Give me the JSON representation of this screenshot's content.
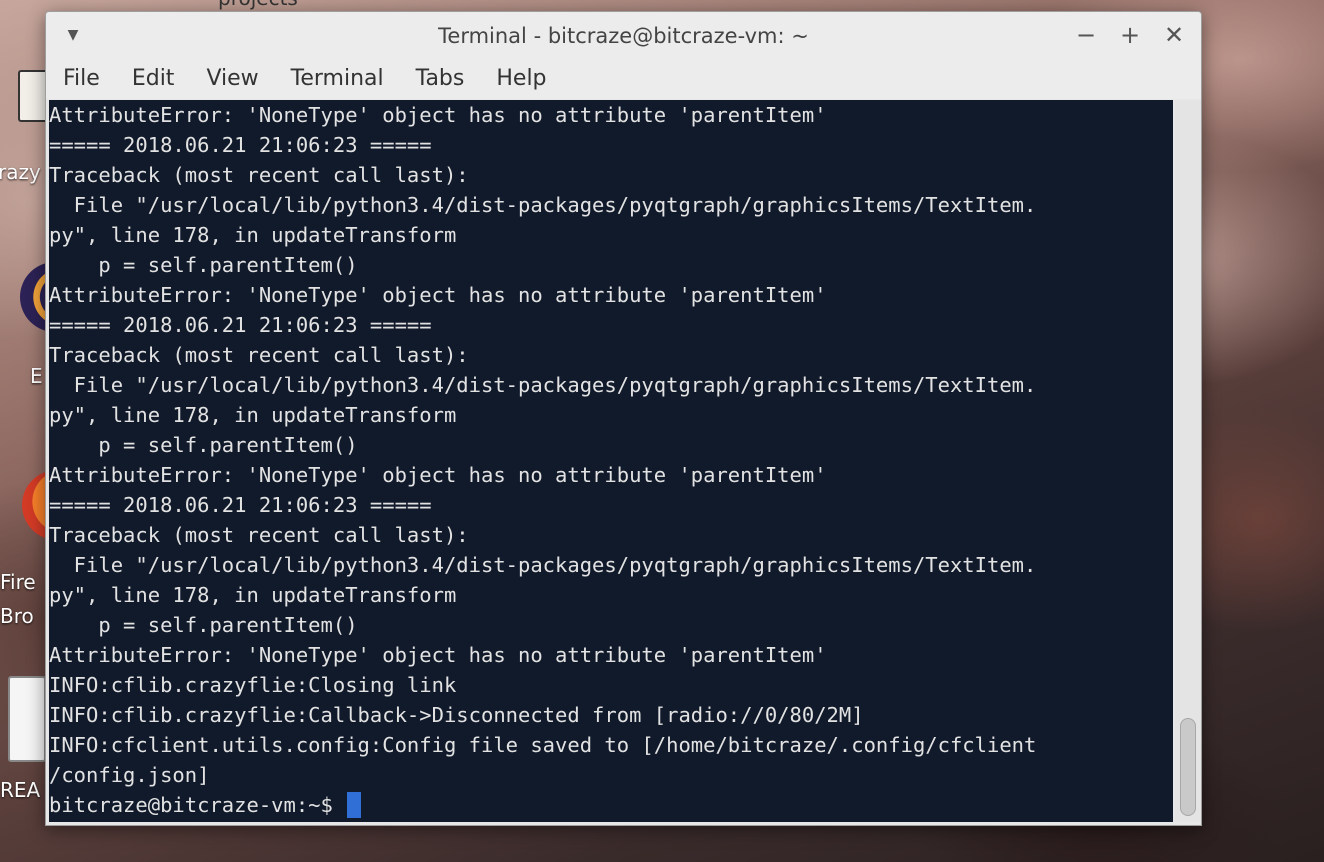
{
  "desktop": {
    "icons": [
      {
        "name": "desktop-icon-crazyflie",
        "label": "razy"
      },
      {
        "name": "desktop-icon-eclipse",
        "label": "E"
      },
      {
        "name": "desktop-icon-firefox",
        "label": "Fire"
      },
      {
        "name": "desktop-icon-firefox-2",
        "label": "Bro"
      },
      {
        "name": "desktop-icon-readme",
        "label": "REA"
      }
    ],
    "top_label": "projects"
  },
  "window": {
    "title": "Terminal - bitcraze@bitcraze-vm: ~",
    "controls": {
      "menu_glyph": "▼",
      "minimize_glyph": "−",
      "maximize_glyph": "+",
      "close_glyph": "✕"
    },
    "menu": [
      "File",
      "Edit",
      "View",
      "Terminal",
      "Tabs",
      "Help"
    ]
  },
  "terminal": {
    "lines": [
      "AttributeError: 'NoneType' object has no attribute 'parentItem'",
      "===== 2018.06.21 21:06:23 =====",
      "Traceback (most recent call last):",
      "  File \"/usr/local/lib/python3.4/dist-packages/pyqtgraph/graphicsItems/TextItem.",
      "py\", line 178, in updateTransform",
      "    p = self.parentItem()",
      "AttributeError: 'NoneType' object has no attribute 'parentItem'",
      "===== 2018.06.21 21:06:23 =====",
      "Traceback (most recent call last):",
      "  File \"/usr/local/lib/python3.4/dist-packages/pyqtgraph/graphicsItems/TextItem.",
      "py\", line 178, in updateTransform",
      "    p = self.parentItem()",
      "AttributeError: 'NoneType' object has no attribute 'parentItem'",
      "===== 2018.06.21 21:06:23 =====",
      "Traceback (most recent call last):",
      "  File \"/usr/local/lib/python3.4/dist-packages/pyqtgraph/graphicsItems/TextItem.",
      "py\", line 178, in updateTransform",
      "    p = self.parentItem()",
      "AttributeError: 'NoneType' object has no attribute 'parentItem'",
      "INFO:cflib.crazyflie:Closing link",
      "INFO:cflib.crazyflie:Callback->Disconnected from [radio://0/80/2M]",
      "INFO:cfclient.utils.config:Config file saved to [/home/bitcraze/.config/cfclient",
      "/config.json]"
    ],
    "prompt": "bitcraze@bitcraze-vm:~$",
    "colors": {
      "background": "#111a2b",
      "foreground": "#e2e2e2",
      "cursor": "#2f6fd6"
    }
  }
}
